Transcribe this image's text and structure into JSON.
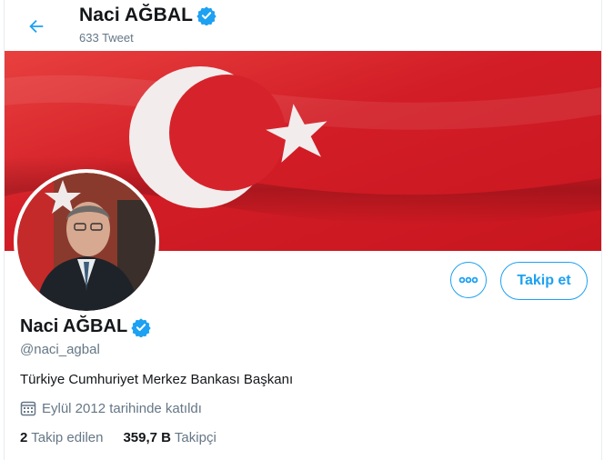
{
  "header": {
    "name": "Naci AĞBAL",
    "tweet_count": "633 Tweet"
  },
  "profile": {
    "name": "Naci AĞBAL",
    "handle": "@naci_agbal",
    "bio": "Türkiye Cumhuriyet Merkez Bankası Başkanı",
    "joined": "Eylül 2012 tarihinde katıldı",
    "following_count": "2",
    "following_label": "Takip edilen",
    "followers_count": "359,7 B",
    "followers_label": "Takipçi"
  },
  "actions": {
    "follow_label": "Takip et",
    "more_icon": "more-horizontal-icon"
  },
  "colors": {
    "accent": "#1da1f2",
    "banner_red": "#d4202a",
    "muted": "#657786"
  }
}
